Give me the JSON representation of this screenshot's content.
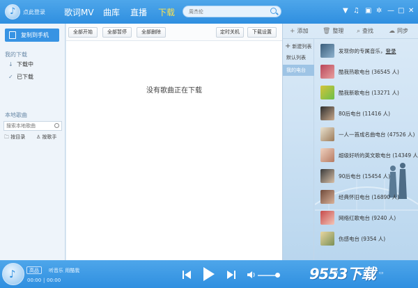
{
  "topbar": {
    "login": "点此登录",
    "nav": [
      "歌词MV",
      "曲库",
      "直播",
      "下载"
    ],
    "search_placeholder": "周杰伦"
  },
  "left": {
    "copy_button": "复制到手机",
    "my_downloads": "我的下载",
    "downloading": "下载中",
    "downloaded": "已下载",
    "local_songs": "本地歌曲",
    "local_search_placeholder": "搜索本地歌曲",
    "by_dir": "按目录",
    "by_singer": "按歌手"
  },
  "center": {
    "buttons": [
      "全部开始",
      "全部暂停",
      "全部删除"
    ],
    "timer_button": "定时关机",
    "settings_button": "下载设置",
    "empty_message": "没有歌曲正在下载"
  },
  "right": {
    "tools": [
      "添加",
      "整理",
      "查找",
      "同步"
    ],
    "new_list": "新建列表",
    "lists": [
      "默认列表",
      "我的电台"
    ],
    "radios": [
      {
        "name": "发现你的专属音乐，",
        "extra": "登录"
      },
      {
        "name": "酷我热歌电台 (36545 人)"
      },
      {
        "name": "酷我新歌电台 (13271 人)"
      },
      {
        "name": "80后电台 (11416 人)"
      },
      {
        "name": "一人一首成名曲电台 (47526 人)"
      },
      {
        "name": "超级好听的英文歌电台 (14349 人"
      },
      {
        "name": "90后电台 (15454 人)"
      },
      {
        "name": "经典怀旧电台 (16890 人)"
      },
      {
        "name": "网络红歌电台 (9240 人)"
      },
      {
        "name": "伤感电台 (9354 人)"
      }
    ]
  },
  "player": {
    "quality": "高品",
    "track": "听音乐 用酷我",
    "time_current": "00:00",
    "time_total": "00:00",
    "watermark": "9553下载"
  }
}
